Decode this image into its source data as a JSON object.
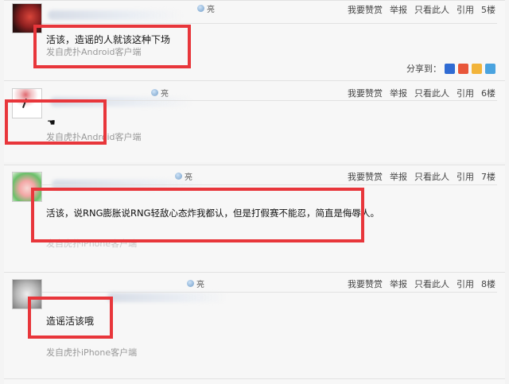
{
  "posts": [
    {
      "tag": "亮",
      "actions": [
        "我要赞赏",
        "举报",
        "只看此人",
        "引用"
      ],
      "floor": "5楼",
      "content": "活该，造谣的人就该这种下场",
      "source": "发自虎扑Android客户端",
      "share_label": "分享到："
    },
    {
      "tag": "亮",
      "actions": [
        "我要赞赏",
        "举报",
        "只看此人",
        "引用"
      ],
      "floor": "6楼",
      "content": "",
      "source": "发自虎扑Android客户端"
    },
    {
      "tag": "亮",
      "actions": [
        "我要赞赏",
        "举报",
        "只看此人",
        "引用"
      ],
      "floor": "7楼",
      "content": "活该，说RNG膨胀说RNG轻敌心态炸我都认，但是打假赛不能忍，简直是侮辱人。",
      "source": "发自虎扑iPhone客户端"
    },
    {
      "tag": "亮",
      "actions": [
        "我要赞赏",
        "举报",
        "只看此人",
        "引用"
      ],
      "floor": "8楼",
      "content": "造谣活该哦",
      "source": "发自虎扑iPhone客户端"
    }
  ],
  "share_icons": [
    "baidu-icon",
    "weibo-icon",
    "qzone-icon",
    "qq-icon"
  ],
  "colors": {
    "highlight": "#e8363b",
    "background": "#f7f7f7"
  }
}
